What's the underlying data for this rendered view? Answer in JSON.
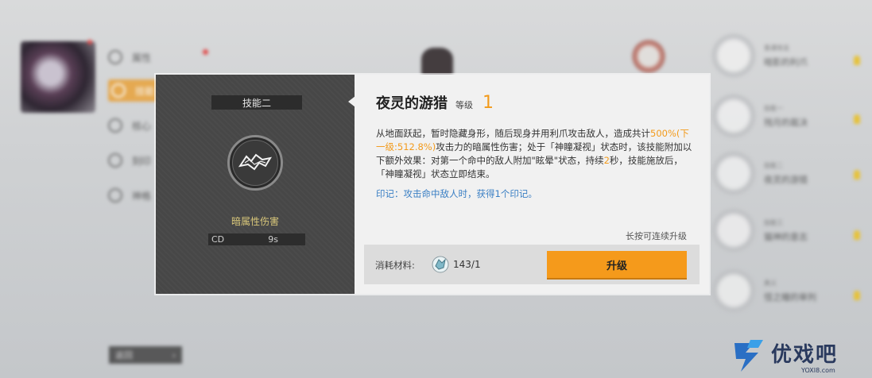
{
  "background": {
    "menu": [
      {
        "label": "属性",
        "active": false
      },
      {
        "label": "技能",
        "active": true
      },
      {
        "label": "核心",
        "active": false
      },
      {
        "label": "刻印",
        "active": false
      },
      {
        "label": "神格",
        "active": false
      }
    ],
    "back_label": "返回",
    "skill_list": [
      {
        "tag": "普通攻击",
        "name": "暗影的利爪"
      },
      {
        "tag": "技能一",
        "name": "残月的裁决"
      },
      {
        "tag": "技能二",
        "name": "夜灵的游猎"
      },
      {
        "tag": "技能三",
        "name": "猫神的意志"
      },
      {
        "tag": "奥义",
        "name": "怪之瞳的审判"
      }
    ]
  },
  "popup": {
    "skill_slot": "技能二",
    "damage_type": "暗属性伤害",
    "cd_label": "CD",
    "cd_value": "9s",
    "skill_name": "夜灵的游猎",
    "level_label": "等级",
    "level_value": "1",
    "desc_part1": "从地面跃起，暂时隐藏身形，随后现身并用利爪攻击敌人，造成共计",
    "desc_highlight1": "500%(下一级:512.8%)",
    "desc_part2": "攻击力的暗属性伤害；处于「神瞳凝视」状态时，该技能附加以下额外效果：对第一个命中的敌人附加\"眩晕\"状态，持续",
    "desc_highlight2": "2",
    "desc_part3": "秒，技能施放后，「神瞳凝视」状态立即结束。",
    "mark_text": "印记：攻击命中敌人时，获得1个印记。",
    "hold_tip": "长按可连续升级",
    "cost_label": "消耗材料:",
    "cost_count": "143/1",
    "upgrade_label": "升级"
  },
  "watermark": {
    "brand": "优戏吧",
    "url": "YOXI8.com"
  },
  "colors": {
    "accent": "#f59a1b",
    "level": "#f29a1a",
    "mark": "#3a7fc4",
    "damage_type": "#d9c77a"
  }
}
